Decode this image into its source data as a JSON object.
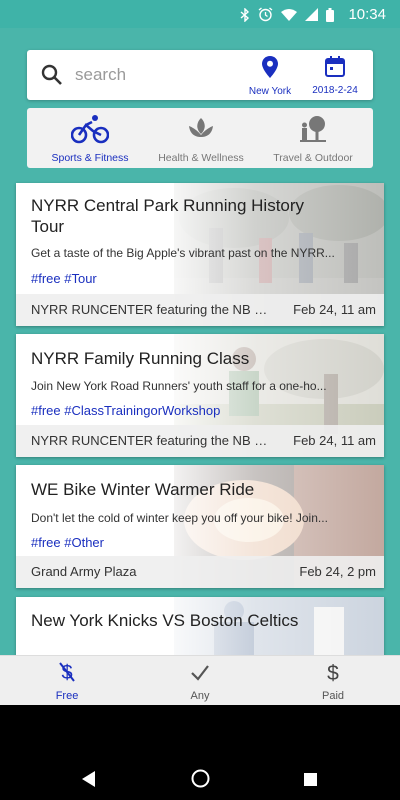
{
  "status_bar": {
    "time": "10:34",
    "icons": [
      "bluetooth-icon",
      "alarm-icon",
      "wifi-icon",
      "signal-icon",
      "battery-icon"
    ]
  },
  "colors": {
    "accent": "#4ab5aa",
    "link": "#1a2fbf"
  },
  "search": {
    "placeholder": "search",
    "location": "New York",
    "date": "2018-2-24"
  },
  "categories": [
    {
      "label": "Sports & Fitness",
      "icon": "bicycle-icon",
      "active": true
    },
    {
      "label": "Health & Wellness",
      "icon": "lotus-icon",
      "active": false
    },
    {
      "label": "Travel & Outdoor",
      "icon": "tree-icon",
      "active": false
    }
  ],
  "events": [
    {
      "title": "NYRR Central Park Running History Tour",
      "description": "Get a taste of the Big Apple's vibrant past on the NYRR...",
      "tags": "#free #Tour",
      "venue": "NYRR RUNCENTER featuring the NB Runn...",
      "when": "Feb 24, 11 am"
    },
    {
      "title": "NYRR Family Running Class",
      "description": "Join New York Road Runners' youth staff for a one-ho...",
      "tags": "#free #ClassTrainingorWorkshop",
      "venue": "NYRR RUNCENTER featuring the NB Runn...",
      "when": "Feb 24, 11 am"
    },
    {
      "title": "WE Bike Winter Warmer Ride",
      "description": "Don't let the cold of winter keep you off your bike! Join...",
      "tags": "#free #Other",
      "venue": "Grand Army Plaza",
      "when": "Feb 24, 2 pm"
    },
    {
      "title": "New York Knicks VS Boston Celtics"
    }
  ],
  "bottom_tabs": [
    {
      "label": "Free",
      "icon": "no-dollar-icon",
      "active": true
    },
    {
      "label": "Any",
      "icon": "check-icon",
      "active": false
    },
    {
      "label": "Paid",
      "icon": "dollar-icon",
      "active": false
    }
  ]
}
